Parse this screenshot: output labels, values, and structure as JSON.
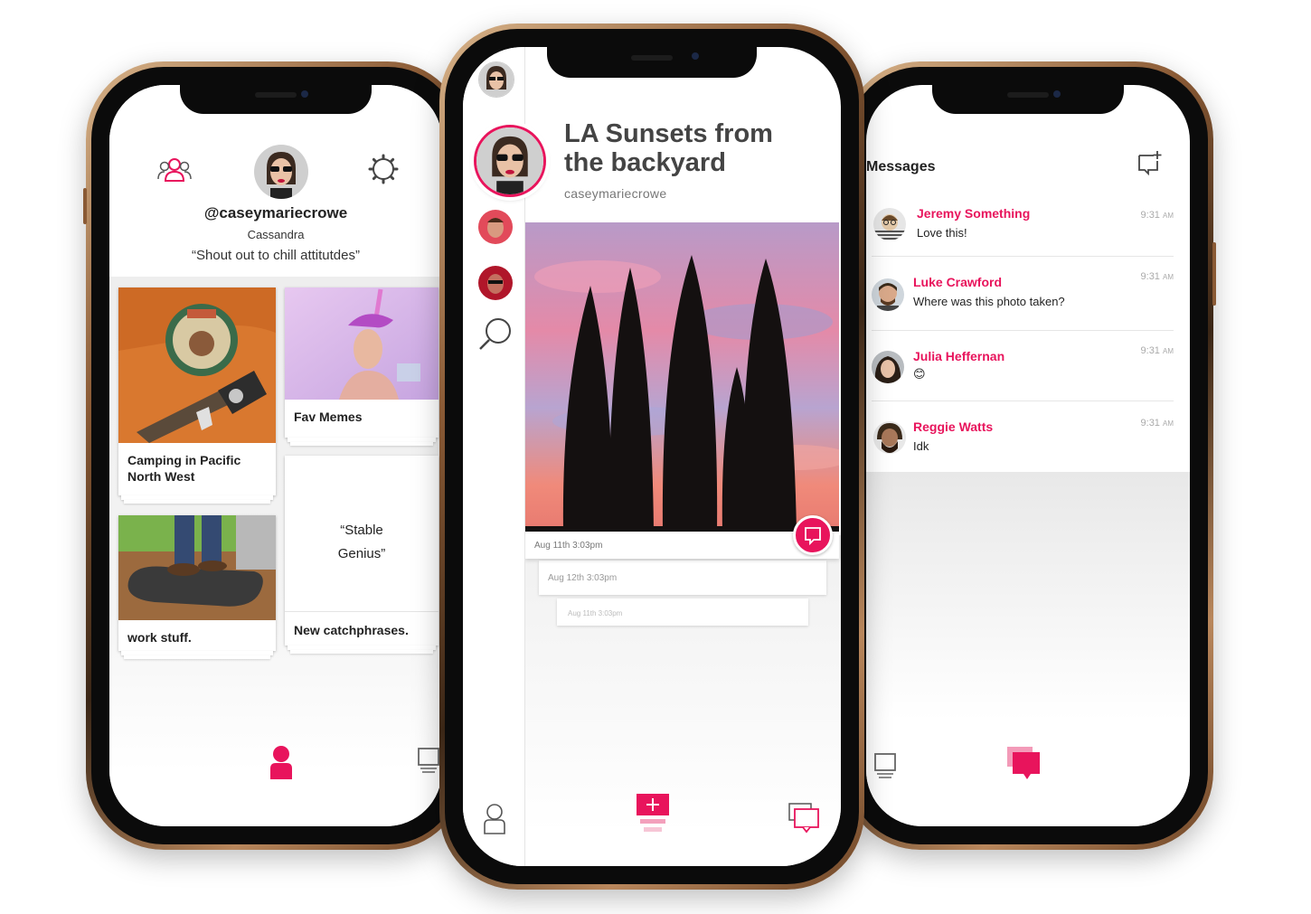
{
  "colors": {
    "accent": "#e8145c",
    "bezel": "#b9875c"
  },
  "profile": {
    "handle": "@caseymariecrowe",
    "name": "Cassandra",
    "bio": "“Shout out to chill attitutdes”",
    "icons": {
      "left": "people-icon",
      "right": "gear-icon"
    }
  },
  "collections": [
    {
      "title": "Camping in Pacific North West"
    },
    {
      "title": "Fav Memes"
    },
    {
      "title": "work stuff."
    },
    {
      "title": "New catchphrases.",
      "quote": "“Stable Genius”"
    }
  ],
  "post": {
    "title": "LA Sunsets from the backyard",
    "author": "caseymariecrowe",
    "timestamp": "Aug 11th 3:03pm",
    "stack": [
      "Aug 12th 3:03pm",
      "Aug 11th 3:03pm"
    ]
  },
  "messages": {
    "title": "Messages",
    "items": [
      {
        "name": "Jeremy Something",
        "text": "Love this!",
        "time": "9:31",
        "ampm": "AM"
      },
      {
        "name": "Luke Crawford",
        "text": "Where was this photo taken?",
        "time": "9:31",
        "ampm": "AM"
      },
      {
        "name": "Julia Heffernan",
        "text": "😊",
        "time": "9:31",
        "ampm": "AM"
      },
      {
        "name": "Reggie Watts",
        "text": "Idk",
        "time": "9:31",
        "ampm": "AM"
      }
    ]
  }
}
